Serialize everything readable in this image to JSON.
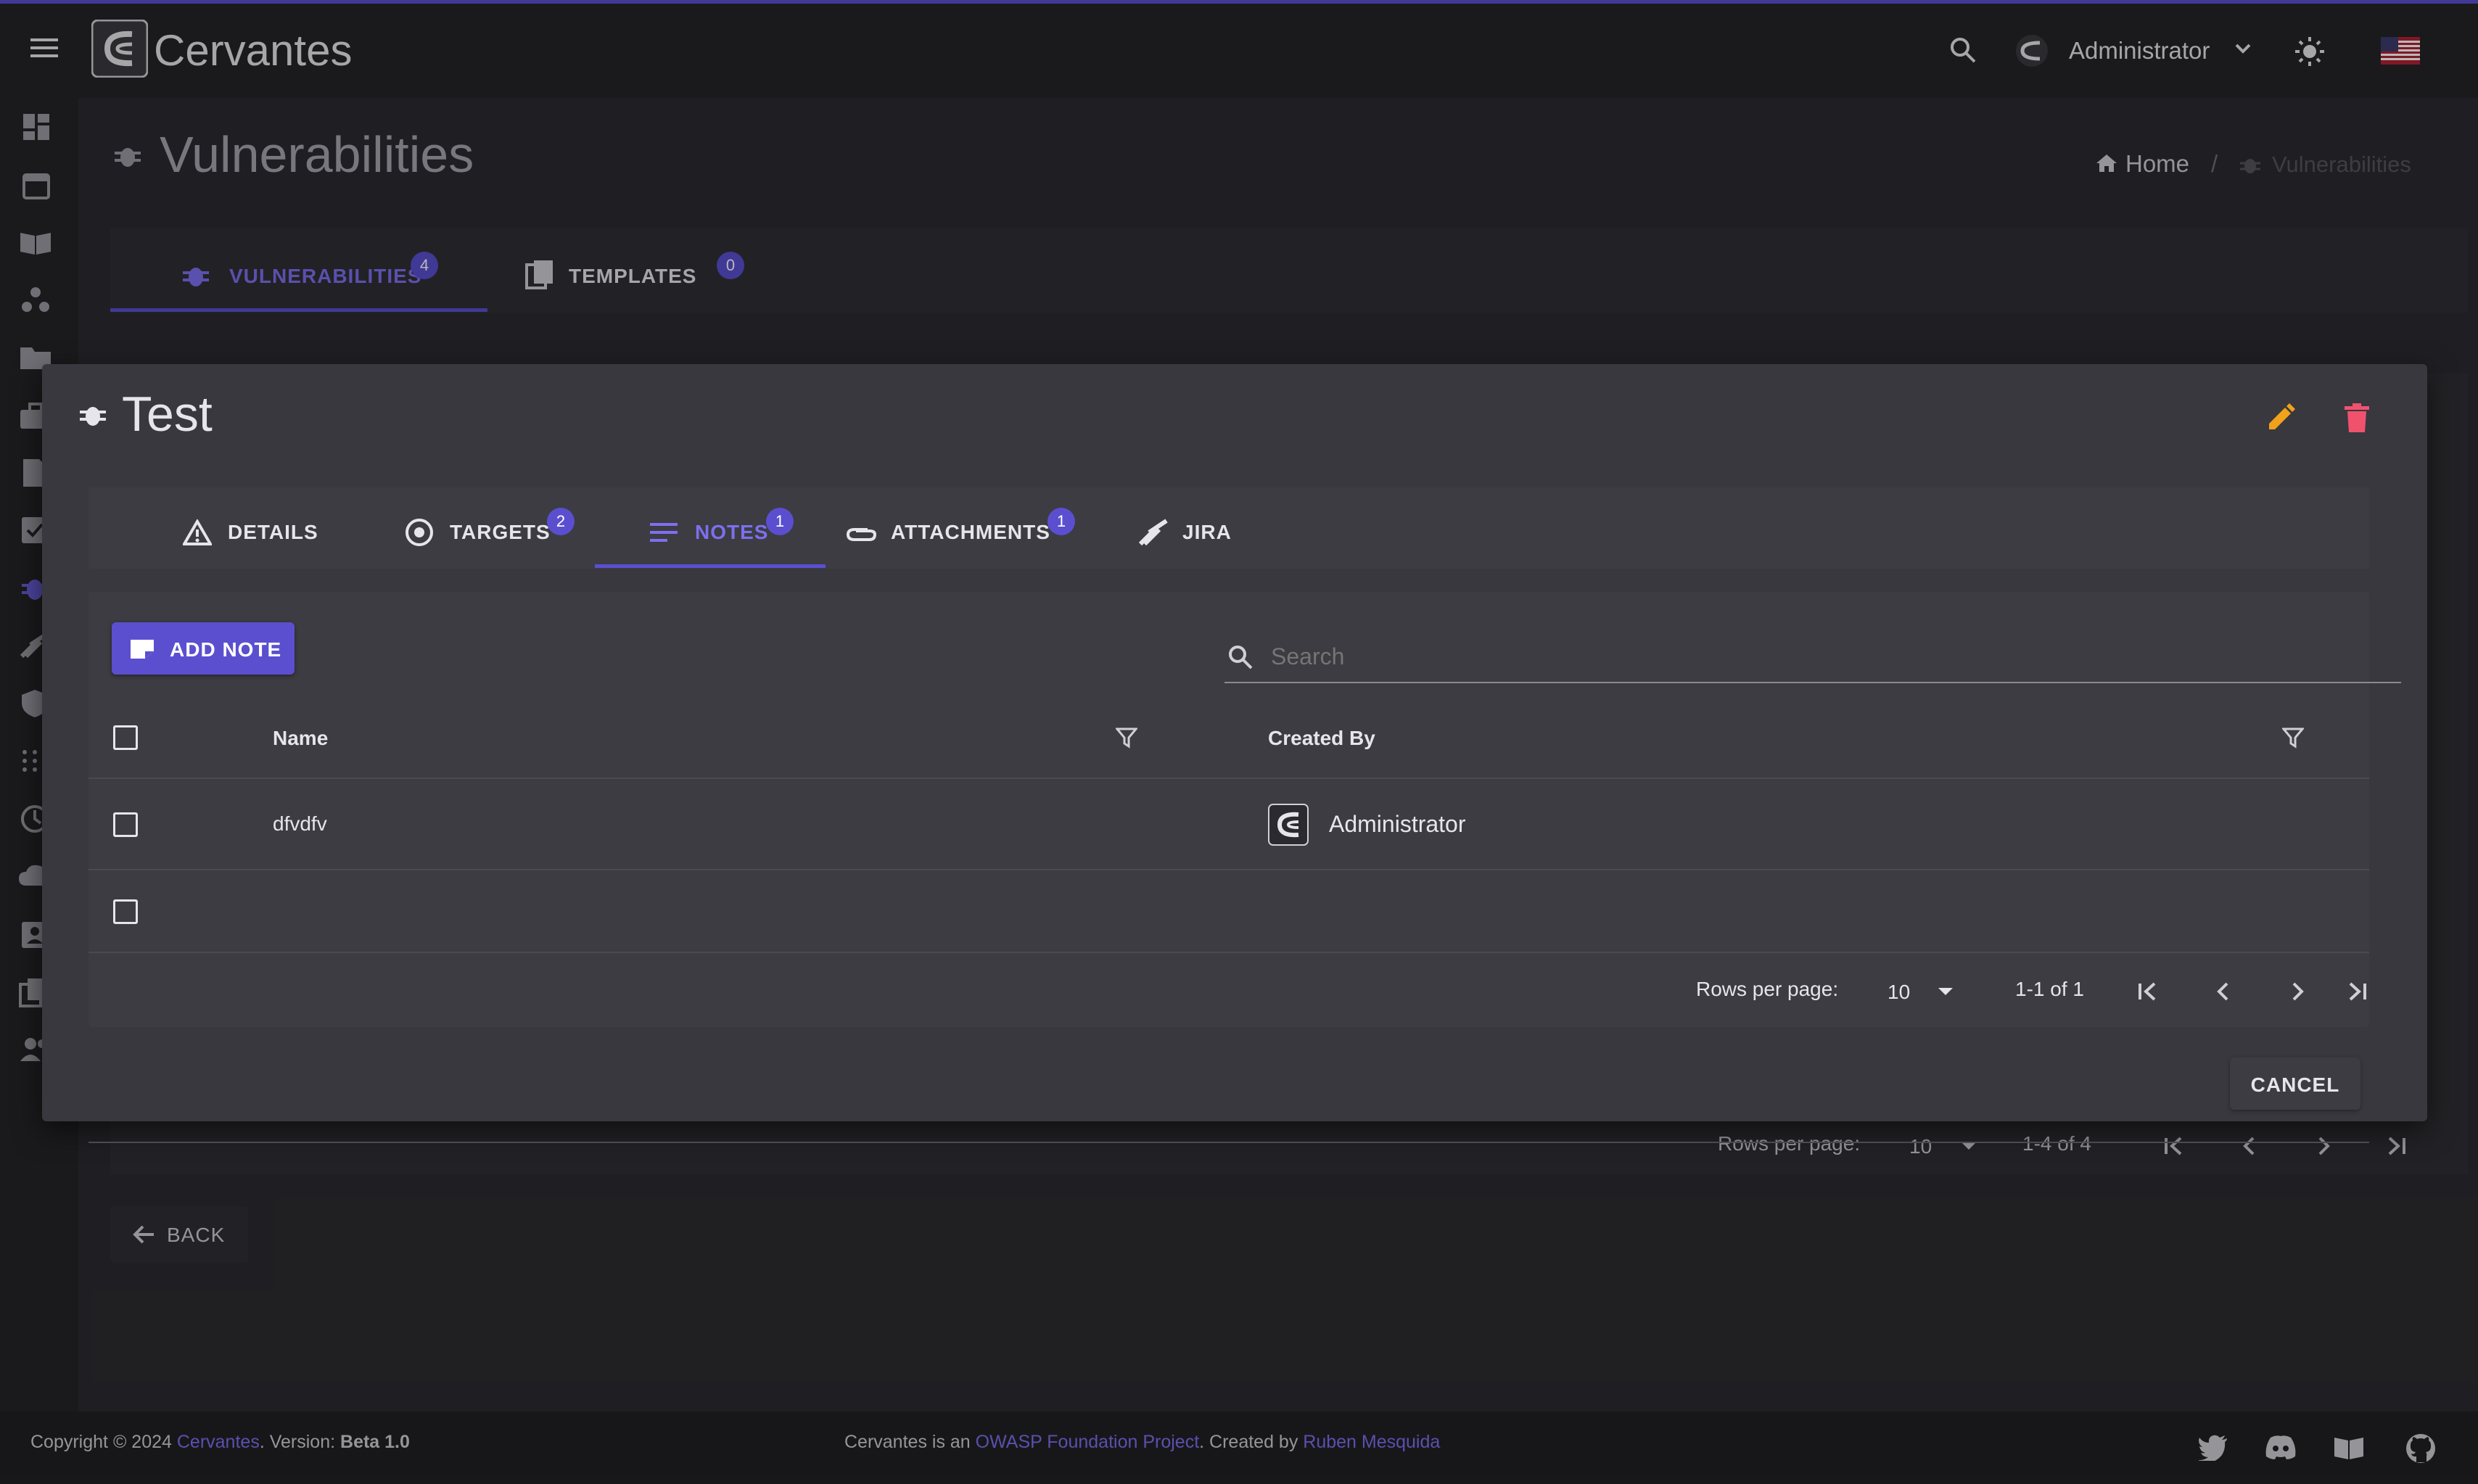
{
  "app": {
    "name": "Cervantes"
  },
  "topbar": {
    "user": "Administrator"
  },
  "page": {
    "title": "Vulnerabilities"
  },
  "breadcrumb": {
    "home": "Home",
    "current": "Vulnerabilities"
  },
  "page_tabs": [
    {
      "label": "VULNERABILITIES",
      "count": "4"
    },
    {
      "label": "TEMPLATES",
      "count": "0"
    }
  ],
  "background_pagination": {
    "rows_label": "Rows per page:",
    "rows_value": "10",
    "range": "1-4 of 4"
  },
  "back_label": "BACK",
  "dialog": {
    "title": "Test",
    "tabs": [
      {
        "label": "DETAILS",
        "count": ""
      },
      {
        "label": "TARGETS",
        "count": "2"
      },
      {
        "label": "NOTES",
        "count": "1"
      },
      {
        "label": "ATTACHMENTS",
        "count": "1"
      },
      {
        "label": "JIRA",
        "count": ""
      }
    ],
    "add_button": "ADD NOTE",
    "search_placeholder": "Search",
    "columns": [
      "Name",
      "Created By"
    ],
    "rows": [
      {
        "name": "dfvdfv",
        "created_by": "Administrator"
      }
    ],
    "pagination": {
      "rows_label": "Rows per page:",
      "rows_value": "10",
      "range": "1-1 of 1"
    },
    "cancel": "CANCEL"
  },
  "footer": {
    "copyright": "Copyright © 2024",
    "brand": "Cervantes",
    "version_label": ". Version:",
    "version": "Beta 1.0",
    "project_prefix": "Cervantes is an",
    "project_link": "OWASP Foundation Project",
    "created_by": ". Created by",
    "author": "Ruben Mesquida"
  },
  "colors": {
    "accent": "#5b4fd0",
    "accent_text": "#7d6ff0",
    "edit": "#f0a21a",
    "delete": "#f0526e"
  },
  "icons": [
    "menu-icon",
    "search-icon",
    "theme-sun-icon",
    "us-flag-icon",
    "bug-icon",
    "home-icon",
    "templates-icon",
    "warning-icon",
    "target-icon",
    "notes-icon",
    "attachment-icon",
    "jira-icon",
    "note-add-icon",
    "filter-icon",
    "first-page-icon",
    "prev-page-icon",
    "next-page-icon",
    "last-page-icon",
    "edit-icon",
    "delete-icon",
    "twitter-icon",
    "discord-icon",
    "docs-icon",
    "github-icon"
  ]
}
